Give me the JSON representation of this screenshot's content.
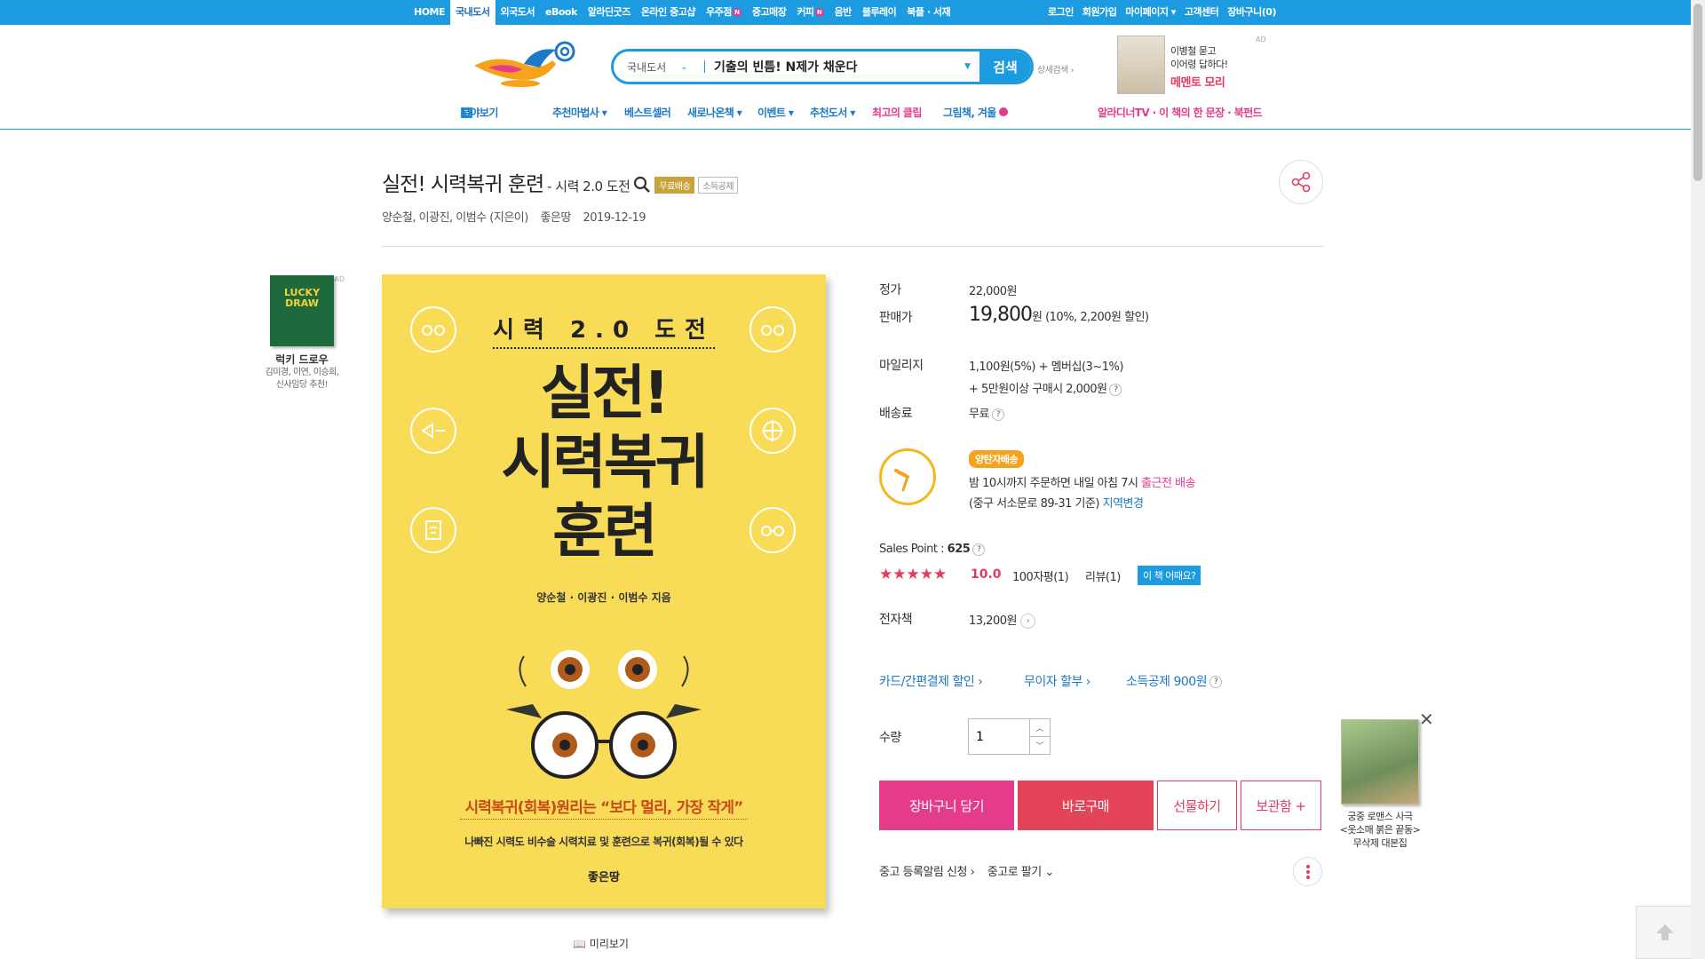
{
  "topbar": {
    "menu": [
      {
        "label": "HOME"
      },
      {
        "label": "국내도서",
        "active": true
      },
      {
        "label": "외국도서"
      },
      {
        "label": "eBook"
      },
      {
        "label": "알라딘굿즈"
      },
      {
        "label": "온라인 중고샵"
      },
      {
        "label": "우주점",
        "badge": "N"
      },
      {
        "label": "중고매장"
      },
      {
        "label": "커피",
        "badge": "N"
      },
      {
        "label": "음반"
      },
      {
        "label": "블루레이"
      },
      {
        "label": "북플 · 서재"
      }
    ],
    "right": [
      "로그인",
      "회원가입",
      "마이페이지 ▾",
      "고객센터",
      "장바구니(0)"
    ]
  },
  "search": {
    "category": "국내도서",
    "value": "기출의 빈틈! N제가 채운다",
    "button": "검색",
    "detail": "상세검색 ›"
  },
  "top_ad": {
    "line1": "이병철 묻고",
    "line2": "이어령 답하다!",
    "line3": "메멘토 모리",
    "ad_label": "AD"
  },
  "gnb": {
    "browse": "분야보기",
    "items": [
      "추천마법사 ▾",
      "베스트셀러",
      "새로나온책 ▾",
      "이벤트 ▾",
      "추천도서 ▾",
      "최고의 클립",
      "그림책, 겨울"
    ],
    "right": "알라디너TV · 이 책의 한 문장 · 북펀드"
  },
  "book": {
    "title": "실전! 시력복귀 훈련",
    "subtitle": "- 시력 2.0 도전",
    "tag_free": "무료배송",
    "tag_tax": "소득공제",
    "authors": "양순철, 이광진, 이범수 (지은이)",
    "publisher": "좋은땅",
    "date": "2019-12-19"
  },
  "left_ad": {
    "cover_text": "LUCKY DRAW",
    "name": "럭키 드로우",
    "desc1": "김미경, 이연, 이승희,",
    "desc2": "신사임당 추천!",
    "ad_label": "AD"
  },
  "cover": {
    "top": "시력 2.0 도전",
    "title_line1": "실전!",
    "title_line2": "시력복귀",
    "title_line3": "훈련",
    "authors": "양순철 · 이광진 · 이범수 지음",
    "slogan": "시력복귀(회복)원리는 “보다 멀리, 가장 작게”",
    "sub": "나빠진 시력도 비수술 시력치료 및 훈련으로 복귀(회복)될 수 있다",
    "publisher": "좋은땅"
  },
  "preview_label": "미리보기",
  "price": {
    "list_label": "정가",
    "list_value": "22,000원",
    "sale_label": "판매가",
    "sale_value": "19,800",
    "sale_unit": "원",
    "sale_discount": "(10%, 2,200원 할인)",
    "mileage_label": "마일리지",
    "mileage_line1": "1,100원(5%) + 멤버십(3~1%)",
    "mileage_line2": "+ 5만원이상 구매시 2,000원",
    "shipping_label": "배송료",
    "shipping_value": "무료"
  },
  "delivery": {
    "badge": "양탄자배송",
    "line1_prefix": "밤 10시까지 주문하면 내일 아침 7시 ",
    "line1_highlight": "출근전 배송",
    "line2_prefix": "(중구 서소문로 89-31 기준) ",
    "line2_link": "지역변경"
  },
  "sales": {
    "label": "Sales Point :",
    "value": "625",
    "stars": "★★★★★",
    "rating": "10.0",
    "count100": "100자평(1)",
    "reviews": "리뷰(1)",
    "how_button": "이 책 어때요?"
  },
  "ebook": {
    "label": "전자책",
    "value": "13,200원"
  },
  "benefits": {
    "card": "카드/간편결제 할인 ›",
    "installment": "무이자 할부 ›",
    "tax": "소득공제 900원"
  },
  "quantity": {
    "label": "수량",
    "value": "1"
  },
  "actions": {
    "cart": "장바구니 담기",
    "buy": "바로구매",
    "gift": "선물하기",
    "wish": "보관함 +"
  },
  "used": {
    "alert": "중고 등록알림 신청 ›",
    "sell": "중고로 팔기 ⌄"
  },
  "float_ad": {
    "line1": "궁중 로맨스 사극",
    "line2": "<옷소매 붉은 끝동>",
    "line3": "무삭제 대본집"
  },
  "colors": {
    "brand_blue": "#1d9be0",
    "pink": "#e43b8a",
    "red": "#e4445a",
    "cover_yellow": "#f8dc57"
  }
}
